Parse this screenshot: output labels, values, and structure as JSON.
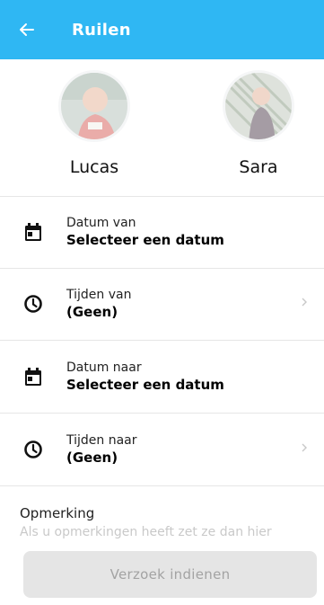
{
  "header": {
    "title": "Ruilen",
    "back_icon": "arrow-left-icon",
    "color": "#2fb7f3"
  },
  "children": [
    {
      "name": "Lucas"
    },
    {
      "name": "Sara"
    }
  ],
  "fields": {
    "date_from": {
      "label": "Datum van",
      "value": "Selecteer een datum",
      "icon": "calendar-icon"
    },
    "times_from": {
      "label": "Tijden van",
      "value": "(Geen)",
      "icon": "clock-icon"
    },
    "date_to": {
      "label": "Datum naar",
      "value": "Selecteer een datum",
      "icon": "calendar-icon"
    },
    "times_to": {
      "label": "Tijden naar",
      "value": "(Geen)",
      "icon": "clock-icon"
    }
  },
  "remark": {
    "label": "Opmerking",
    "placeholder": "Als u opmerkingen heeft zet ze dan hier"
  },
  "submit": {
    "label": "Verzoek indienen"
  }
}
